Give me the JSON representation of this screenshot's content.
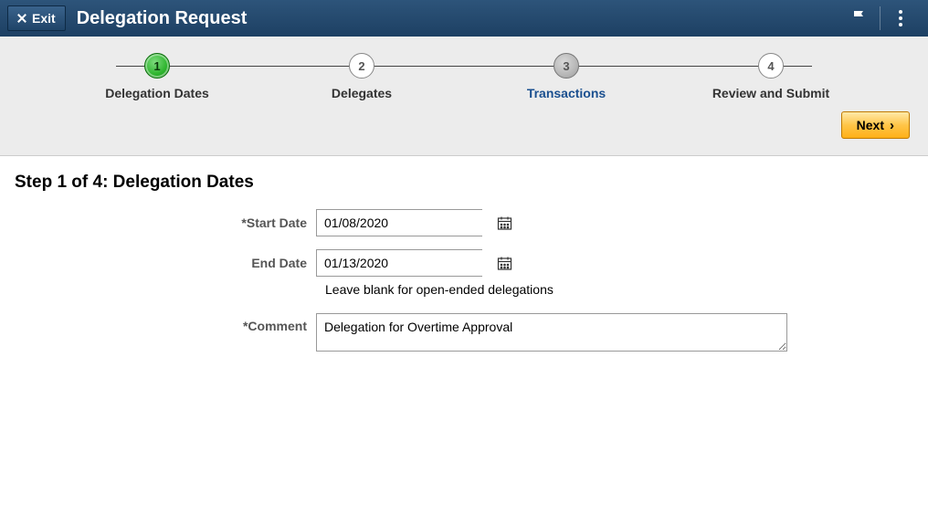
{
  "header": {
    "exit_label": "Exit",
    "title": "Delegation Request"
  },
  "steps": [
    {
      "num": "1",
      "label": "Delegation Dates",
      "state": "current"
    },
    {
      "num": "2",
      "label": "Delegates",
      "state": "future"
    },
    {
      "num": "3",
      "label": "Transactions",
      "state": "link"
    },
    {
      "num": "4",
      "label": "Review and Submit",
      "state": "future"
    }
  ],
  "next_label": "Next",
  "form": {
    "heading": "Step 1 of 4: Delegation Dates",
    "start_date_label": "*Start Date",
    "start_date_value": "01/08/2020",
    "end_date_label": "End Date",
    "end_date_value": "01/13/2020",
    "end_date_hint": "Leave blank for open-ended delegations",
    "comment_label": "*Comment",
    "comment_value": "Delegation for Overtime Approval"
  }
}
